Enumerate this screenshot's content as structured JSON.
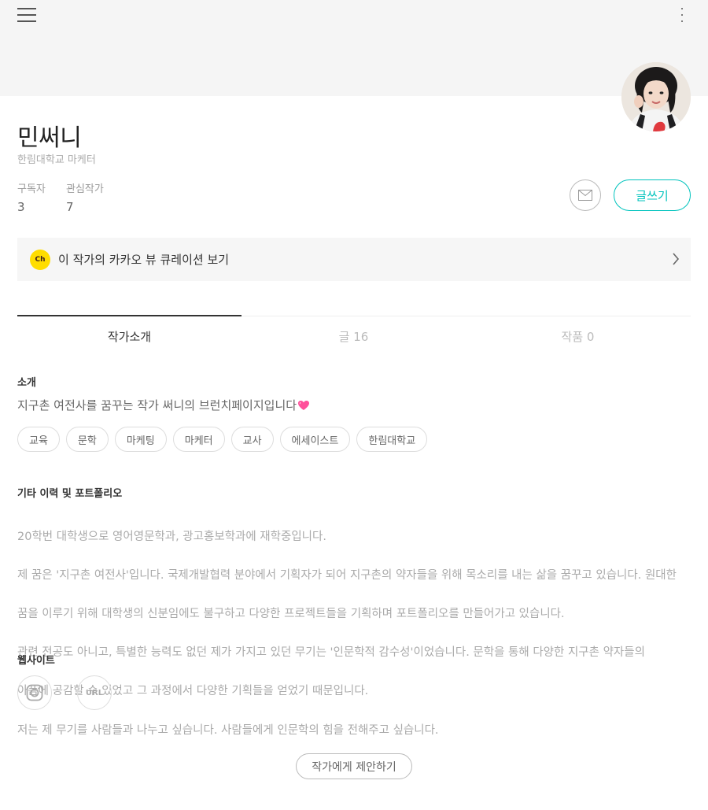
{
  "header": {
    "menu_icon": "hamburger-menu-icon",
    "more_icon": "more-vertical-icon"
  },
  "profile": {
    "name": "민써니",
    "job": "한림대학교 마케터",
    "subscribers_label": "구독자",
    "subscribers_value": "3",
    "following_label": "관심작가",
    "following_value": "7",
    "write_label": "글쓰기"
  },
  "kakao": {
    "badge": "Ch",
    "label": "이 작가의 카카오 뷰 큐레이션 보기"
  },
  "tabs": [
    {
      "label": "작가소개",
      "active": true
    },
    {
      "label": "글 16",
      "active": false
    },
    {
      "label": "작품 0",
      "active": false
    }
  ],
  "about": {
    "title": "소개",
    "text": "지구촌 여전사를 꿈꾸는 작가 써니의 브런치페이지입니다",
    "tags": [
      "교육",
      "문학",
      "마케팅",
      "마케터",
      "교사",
      "에세이스트",
      "한림대학교"
    ]
  },
  "history": {
    "title": "기타 이력 및 포트폴리오",
    "lines": [
      "20학번 대학생으로 영어영문학과, 광고홍보학과에 재학중입니다.",
      "제 꿈은 '지구촌 여전사'입니다. 국제개발협력 분야에서 기획자가 되어 지구촌의 약자들을 위해 목소리를 내는 삶을 꿈꾸고 있습니다. 원대한",
      "꿈을 이루기 위해 대학생의 신분임에도 불구하고 다양한 프로젝트들을 기획하며 포트폴리오를 만들어가고 있습니다.",
      " 관련 전공도 아니고, 특별한 능력도 없던 제가 가지고 있던 무기는 '인문학적 감수성'이었습니다. 문학을 통해 다양한 지구촌 약자들의",
      "아픔에 공감할 수 있었고 그 과정에서 다양한 기획들을 얻었기 때문입니다.",
      "저는 제 무기를 사람들과 나누고 싶습니다. 사람들에게 인문학의 힘을 전해주고 싶습니다."
    ]
  },
  "website": {
    "title": "웹사이트",
    "url_label": "URL"
  },
  "suggest_label": "작가에게 제안하기",
  "colors": {
    "accent": "#00c3bd",
    "kakao_yellow": "#ffdd00"
  }
}
